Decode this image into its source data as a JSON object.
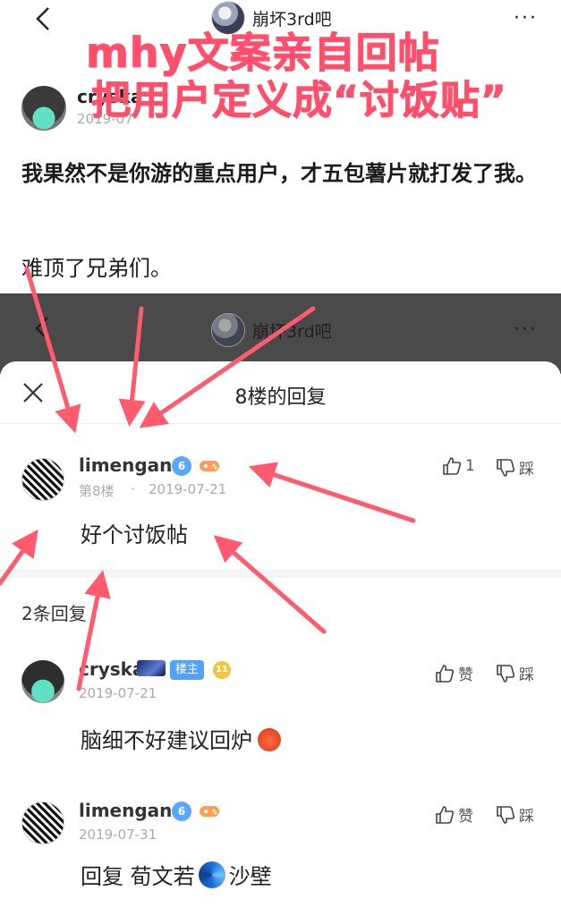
{
  "topnav": {
    "forum_name": "崩坏3rd吧",
    "more": "···"
  },
  "caption": {
    "line1": "mhy文案亲自回帖",
    "line2": "把用户定义成“讨饭贴”"
  },
  "op": {
    "username": "cryska",
    "date": "2019-07",
    "body": "我果然不是你游的重点用户，才五包薯片就打发了我。",
    "body2": "难顶了兄弟们。"
  },
  "dim_nav": {
    "forum_name": "崩坏3rd吧",
    "more": "···"
  },
  "sheet": {
    "title": "8楼的回复",
    "floor": {
      "username": "limengan",
      "badge_num": "6",
      "floor_label": "第8楼",
      "dot": "·",
      "date": "2019-07-21",
      "text": "好个讨饭帖",
      "like_count": "1",
      "dislike_label": "踩"
    },
    "reply_count": "2条回复",
    "replies": [
      {
        "username": "cryska",
        "lz_badge": "楼主",
        "level": "11",
        "date": "2019-07-21",
        "text": "脑细不好建议回炉",
        "like_label": "赞",
        "dislike_label": "踩"
      },
      {
        "username": "limengan",
        "badge_num": "6",
        "date": "2019-07-31",
        "text_prefix": "回复 荀文若",
        "text_suffix": "沙壁",
        "like_label": "赞",
        "dislike_label": "踩"
      }
    ]
  },
  "colors": {
    "caption": "#ff4f6b",
    "arrow": "#ff5a6e",
    "badge_blue": "#5aa7ff",
    "level_gold": "#f4c43a"
  }
}
